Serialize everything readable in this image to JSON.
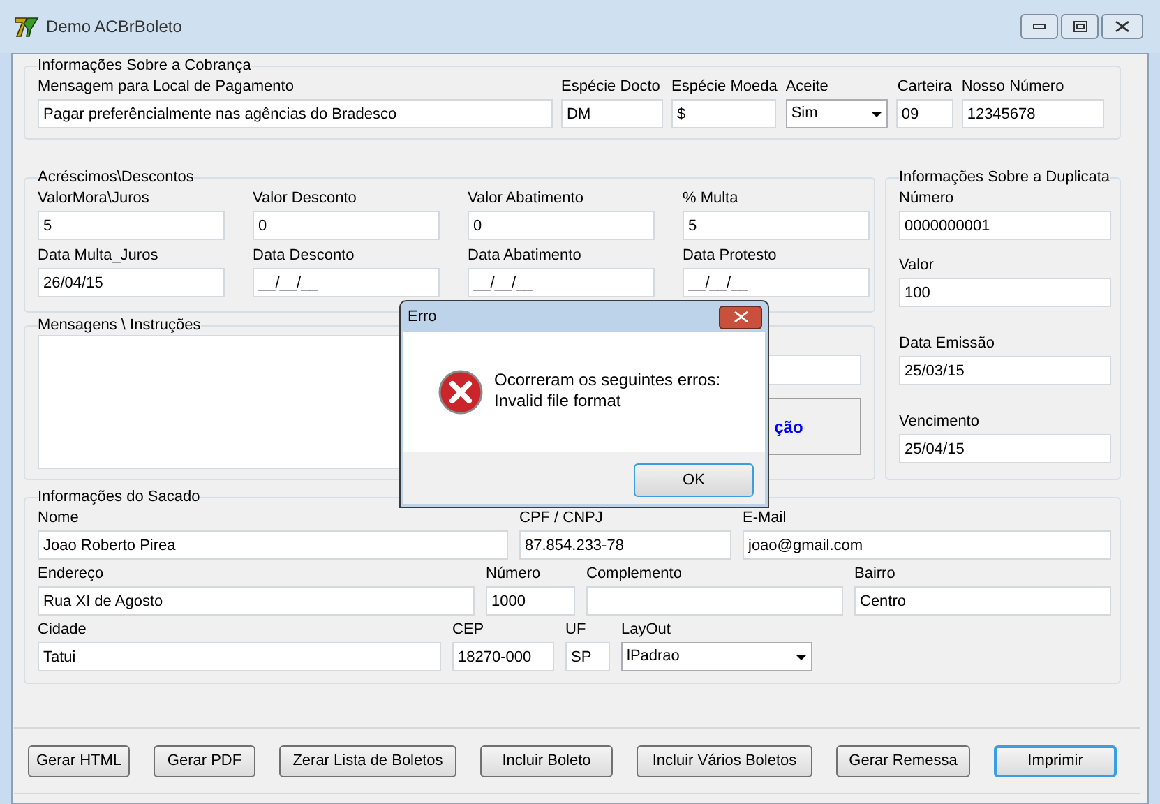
{
  "window": {
    "title": "Demo ACBrBoleto"
  },
  "cobranca": {
    "title": "Informações Sobre a Cobrança",
    "fields": [
      {
        "kind": "text",
        "label": "Mensagem para Local de Pagamento",
        "value": "Pagar preferêncialmente nas agências do Bradesco"
      },
      {
        "kind": "text",
        "label": "Espécie Docto",
        "value": "DM"
      },
      {
        "kind": "text",
        "label": "Espécie Moeda",
        "value": "$"
      },
      {
        "kind": "combo",
        "label": "Aceite",
        "value": "Sim"
      },
      {
        "kind": "text",
        "label": "Carteira",
        "value": "09"
      },
      {
        "kind": "text",
        "label": "Nosso Número",
        "value": "12345678"
      }
    ]
  },
  "acrescimos": {
    "title": "Acréscimos\\Descontos",
    "fields": [
      {
        "kind": "text",
        "label": "ValorMora\\Juros",
        "value": "5"
      },
      {
        "kind": "text",
        "label": "Valor Desconto",
        "value": "0"
      },
      {
        "kind": "text",
        "label": "Valor Abatimento",
        "value": "0"
      },
      {
        "kind": "text",
        "label": "% Multa",
        "value": "5"
      },
      {
        "kind": "text",
        "label": "Data Multa_Juros",
        "value": "26/04/15"
      },
      {
        "kind": "text",
        "label": "Data Desconto",
        "value": "__/__/__"
      },
      {
        "kind": "text",
        "label": "Data Abatimento",
        "value": "__/__/__"
      },
      {
        "kind": "text",
        "label": "Data Protesto",
        "value": "__/__/__"
      }
    ]
  },
  "mensagens": {
    "title": "Mensagens \\ Instruções",
    "side_button": "ção"
  },
  "duplicata": {
    "title": "Informações Sobre a Duplicata",
    "fields": [
      {
        "kind": "text",
        "label": "Número",
        "value": "0000000001"
      },
      {
        "kind": "text",
        "label": "Valor",
        "value": "100"
      },
      {
        "kind": "text",
        "label": "Data Emissão",
        "value": "25/03/15"
      },
      {
        "kind": "text",
        "label": "Vencimento",
        "value": "25/04/15"
      }
    ]
  },
  "sacado": {
    "title": "Informações do Sacado",
    "fields": [
      {
        "kind": "text",
        "label": "Nome",
        "value": "Joao Roberto Pirea"
      },
      {
        "kind": "text",
        "label": "CPF / CNPJ",
        "value": "87.854.233-78"
      },
      {
        "kind": "text",
        "label": "E-Mail",
        "value": "joao@gmail.com"
      },
      {
        "kind": "text",
        "label": "Endereço",
        "value": "Rua XI de Agosto"
      },
      {
        "kind": "text",
        "label": "Número",
        "value": "1000"
      },
      {
        "kind": "text",
        "label": "Complemento"
      },
      {
        "kind": "text",
        "label": "Bairro",
        "value": "Centro"
      },
      {
        "kind": "text",
        "label": "Cidade",
        "value": "Tatui"
      },
      {
        "kind": "text",
        "label": "CEP",
        "value": "18270-000"
      },
      {
        "kind": "text",
        "label": "UF",
        "value": "SP"
      },
      {
        "kind": "combo",
        "label": "LayOut",
        "value": "lPadrao"
      }
    ]
  },
  "buttons": [
    {
      "label": "Gerar HTML",
      "default": false
    },
    {
      "label": "Gerar PDF",
      "default": false
    },
    {
      "label": "Zerar Lista de Boletos",
      "default": false
    },
    {
      "label": "Incluir Boleto",
      "default": false
    },
    {
      "label": "Incluir Vários Boletos",
      "default": false
    },
    {
      "label": "Gerar Remessa",
      "default": false
    },
    {
      "label": "Imprimir",
      "default": true
    }
  ],
  "dialog": {
    "title": "Erro",
    "message_lines": [
      "Ocorreram os seguintes erros:",
      "Invalid file format"
    ],
    "button": "OK"
  }
}
